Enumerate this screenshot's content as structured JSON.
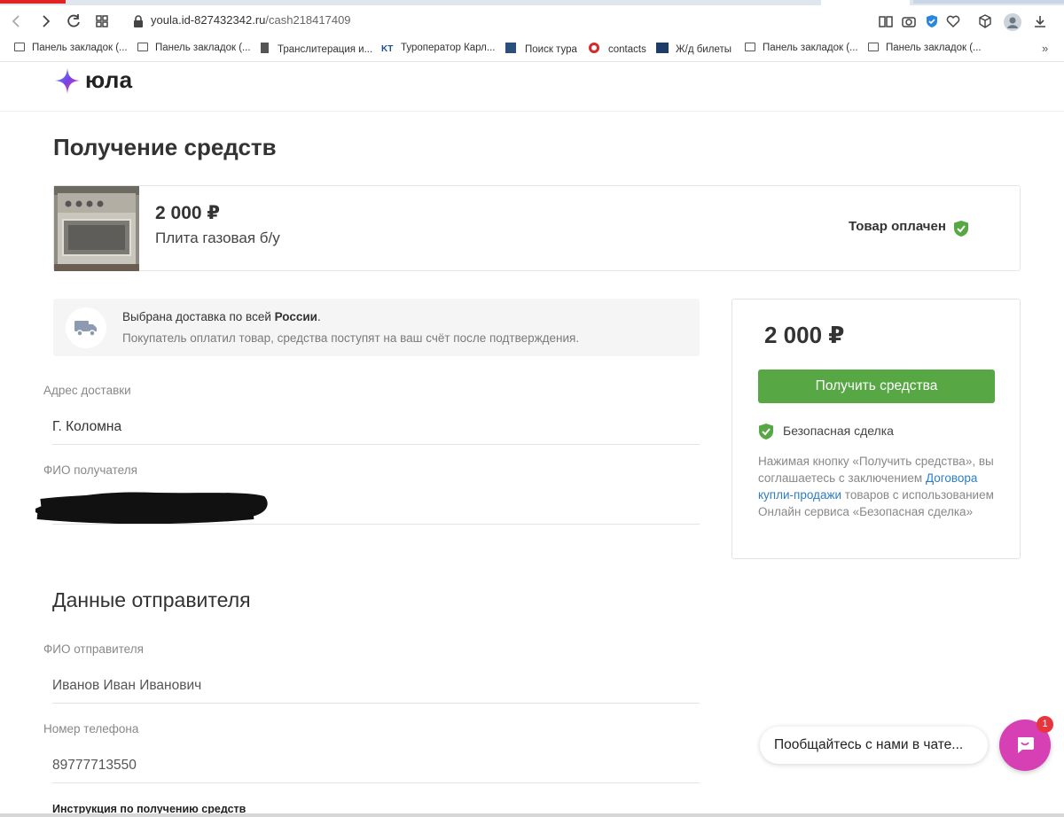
{
  "browser": {
    "url_host": "youla.id-827432342.ru",
    "url_path": "/cash218417409",
    "bookmarks": [
      {
        "label": "Панель закладок (...",
        "icon": "folder-icon"
      },
      {
        "label": "Панель закладок (...",
        "icon": "folder-icon"
      },
      {
        "label": "Транслитерация и...",
        "icon": "document-icon"
      },
      {
        "label": "Туроператор Карл...",
        "icon": "kt-icon"
      },
      {
        "label": "Поиск тура",
        "icon": "site-icon"
      },
      {
        "label": "contacts",
        "icon": "target-icon"
      },
      {
        "label": "Ж/д билеты",
        "icon": "train-icon"
      },
      {
        "label": "Панель закладок (...",
        "icon": "folder-icon"
      },
      {
        "label": "Панель закладок (...",
        "icon": "folder-icon"
      }
    ],
    "more": "»"
  },
  "header": {
    "logo_text": "юла",
    "logo_colors": [
      "#7b3fe4",
      "#ff4f8b",
      "#3bb8ff"
    ]
  },
  "page": {
    "title": "Получение средств"
  },
  "product": {
    "price": "2 000 ₽",
    "name": "Плита газовая б/у",
    "status": "Товар оплачен"
  },
  "delivery": {
    "line1_prefix": "Выбрана доставка по всей ",
    "line1_bold": "России",
    "line1_suffix": ".",
    "line2": "Покупатель оплатил товар, средства поступят на ваш счёт после подтверждения."
  },
  "recipient": {
    "address_label": "Адрес доставки",
    "address_value": "Г. Коломна",
    "name_label": "ФИО получателя"
  },
  "sender": {
    "section_title": "Данные отправителя",
    "name_label": "ФИО отправителя",
    "name_value": "Иванов Иван Иванович",
    "phone_label": "Номер телефона",
    "phone_value": "89777713550",
    "instructions_title": "Инструкция по получению средств"
  },
  "payment": {
    "amount": "2 000 ₽",
    "button_label": "Получить средства",
    "safe_deal_label": "Безопасная сделка",
    "terms_part1": "Нажимая кнопку «Получить средства», вы соглашаетесь с заключением ",
    "terms_link": "Договора купли-продажи",
    "terms_part2": " товаров с использованием Онлайн сервиса «Безопасная сделка»",
    "accent_color": "#57a844"
  },
  "chat": {
    "bubble_text": "Пообщайтесь с нами в чате...",
    "badge_count": "1",
    "color": "#d73fb4"
  }
}
